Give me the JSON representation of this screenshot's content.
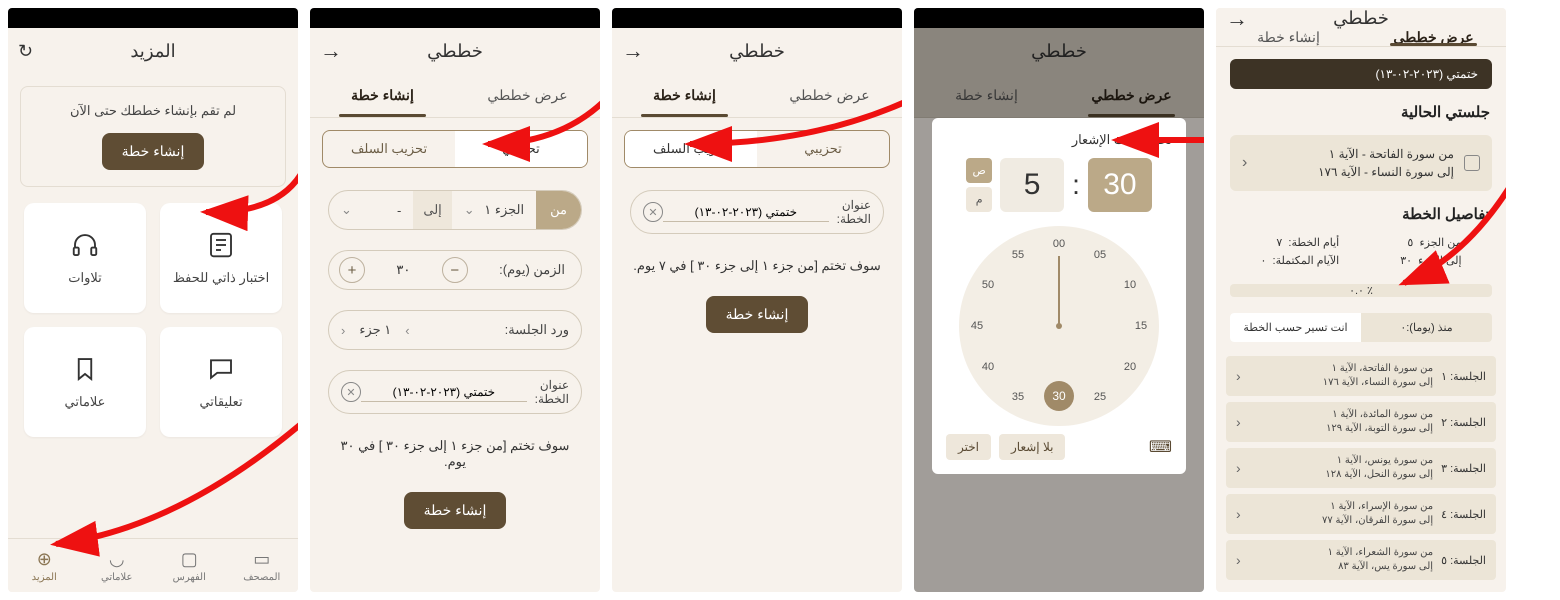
{
  "s1": {
    "title": "المزيد",
    "empty_text": "لم تقم بإنشاء خططك حتى الآن",
    "create_btn": "إنشاء خطة",
    "cards": {
      "test": "اختبار ذاتي للحفظ",
      "recitations": "تلاوات",
      "comments": "تعليقاتي",
      "bookmarks": "علاماتي"
    },
    "nav": {
      "mushaf": "المصحف",
      "index": "الفهرس",
      "bookmarks": "علاماتي",
      "more": "المزيد"
    }
  },
  "s2": {
    "title": "خططي",
    "tab_view": "عرض خططي",
    "tab_create": "إنشاء خطة",
    "sub_own": "تحزيبي",
    "sub_salaf": "تحزيب السلف",
    "from": "من",
    "from_val": "الجزء ١",
    "to": "إلى",
    "to_val": "-",
    "days_label": "الزمن (يوم):",
    "days_val": "٣٠",
    "wird_label": "ورد الجلسة:",
    "wird_val": "١ جزء",
    "title_label": "عنوان\nالخطة:",
    "title_val": "ختمتي (٢٠٢٣-٠٢-١٣)",
    "summary": "سوف تختم [من جزء ١ إلى جزء ٣٠ ] في ٣٠ يوم.",
    "create_btn": "إنشاء خطة"
  },
  "s3": {
    "summary": "سوف تختم [من جزء ١ إلى جزء ٣٠ ] في ٧ يوم.",
    "title_val": "ختمتي (٢٠٢٣-٠٢-١٣)"
  },
  "s4": {
    "dialog_title": "تحديد وقت الإشعار",
    "minutes": "30",
    "hours": "5",
    "am": "ص",
    "pm": "م",
    "clock": [
      "00",
      "05",
      "10",
      "15",
      "20",
      "25",
      "30",
      "35",
      "40",
      "45",
      "50",
      "55"
    ],
    "selected": "30",
    "no_notif": "بلا إشعار",
    "choose": "اختر"
  },
  "s5": {
    "chip": "ختمتي (٢٠٢٣-٠٢-١٣)",
    "current_title": "جلستي الحالية",
    "current_from": "من سورة الفاتحة  -  الآية ١",
    "current_to": "إلى سورة النساء  -  الآية ١٧٦",
    "details_title": "تفاصيل الخطة",
    "meta": {
      "from_juz_l": "من الجزء",
      "from_juz_v": "٥",
      "to_juz_l": "إلى الجزء",
      "to_juz_v": "٣٠",
      "days_l": "أيام الخطة:",
      "days_v": "٧",
      "done_l": "الآيام المكتملة:",
      "done_v": "٠"
    },
    "progress": "٪ ٠.٠",
    "status_since_l": "منذ (يوما):",
    "status_since_v": "٠",
    "status_msg": "انت تسير حسب الخطة",
    "sessions": [
      {
        "n": "الجلسة: ١",
        "from": "من سورة الفاتحة، الآية ١",
        "to": "إلى سورة النساء، الآية ١٧٦"
      },
      {
        "n": "الجلسة: ٢",
        "from": "من سورة المائدة، الآية ١",
        "to": "إلى سورة التوبة، الآية ١٢٩"
      },
      {
        "n": "الجلسة: ٣",
        "from": "من سورة يونس، الآية ١",
        "to": "إلى سورة النحل، الآية ١٢٨"
      },
      {
        "n": "الجلسة: ٤",
        "from": "من سورة الإسراء، الآية ١",
        "to": "إلى سورة الفرقان، الآية ٧٧"
      },
      {
        "n": "الجلسة: ٥",
        "from": "من سورة الشعراء، الآية ١",
        "to": "إلى سورة يس، الآية ٨٣"
      }
    ]
  }
}
